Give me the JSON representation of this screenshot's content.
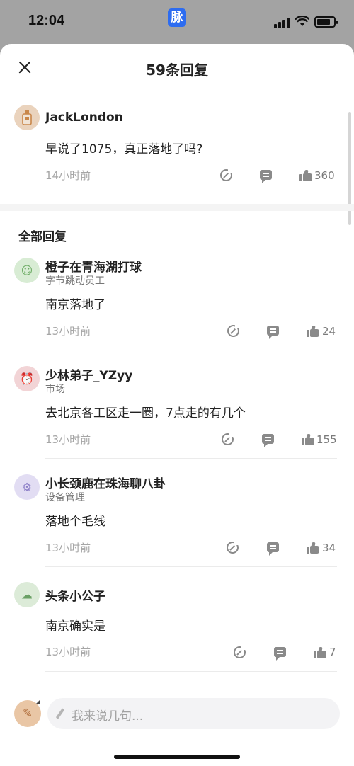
{
  "status_bar": {
    "time": "12:04",
    "app_badge": "脉"
  },
  "header": {
    "title": "59条回复"
  },
  "top_comment": {
    "author": "JackLondon",
    "text": "早说了1075，真正落地了吗?",
    "time": "14小时前",
    "likes": "360",
    "avatar_icon": "perfume-bottle-icon"
  },
  "section": {
    "title": "全部回复"
  },
  "replies": [
    {
      "author": "橙子在青海湖打球",
      "subtitle": "字节跳动员工",
      "text": "南京落地了",
      "time": "13小时前",
      "likes": "24",
      "avatar_color": "#d8ecd4",
      "avatar_glyph": "☺"
    },
    {
      "author": "少林弟子_YZyy",
      "subtitle": "市场",
      "text": "去北京各工区走一圈，7点走的有几个",
      "time": "13小时前",
      "likes": "155",
      "avatar_color": "#f2d4d6",
      "avatar_glyph": "⏰"
    },
    {
      "author": "小长颈鹿在珠海聊八卦",
      "subtitle": "设备管理",
      "text": "落地个毛线",
      "time": "13小时前",
      "likes": "34",
      "avatar_color": "#e2ddf3",
      "avatar_glyph": "⚙"
    },
    {
      "author": "头条小公子",
      "subtitle": "",
      "text": "南京确实是",
      "time": "13小时前",
      "likes": "7",
      "avatar_color": "#dcebd8",
      "avatar_glyph": "☁"
    }
  ],
  "input": {
    "placeholder": "我来说几句..."
  },
  "colors": {
    "accent": "#2d6cf0",
    "icon_gray": "#8a8a8a",
    "time_gray": "#a6a6a6"
  }
}
